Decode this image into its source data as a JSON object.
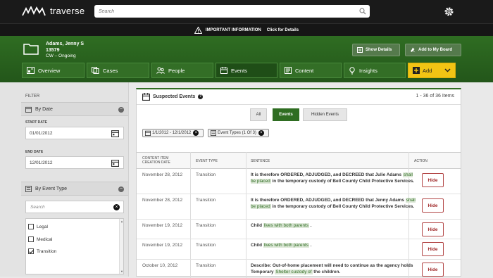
{
  "app": {
    "name": "traverse"
  },
  "search": {
    "placeholder": "Search"
  },
  "info_bar": {
    "label": "IMPORTANT INFORMATION",
    "link": "Click for Details"
  },
  "case": {
    "name": "Adams, Jenny S",
    "id": "13579",
    "status": "CW – Ongoing",
    "show_details": "Show Details",
    "add_board": "Add to My Board"
  },
  "tabs": [
    {
      "label": "Overview",
      "icon": "overview-icon"
    },
    {
      "label": "Cases",
      "icon": "cases-icon"
    },
    {
      "label": "People",
      "icon": "people-icon"
    },
    {
      "label": "Events",
      "icon": "events-icon"
    },
    {
      "label": "Content",
      "icon": "content-icon"
    },
    {
      "label": "Insights",
      "icon": "insights-icon"
    },
    {
      "label": "Add",
      "icon": "add-icon"
    }
  ],
  "sidebar": {
    "filter_label": "FILTER",
    "by_date": {
      "title": "By Date",
      "start_label": "START DATE",
      "start_value": "01/01/2012",
      "end_label": "END DATE",
      "end_value": "12/01/2012"
    },
    "by_event_type": {
      "title": "By Event Type",
      "search_placeholder": "Search",
      "options": [
        {
          "label": "Legal",
          "checked": false
        },
        {
          "label": "Medical",
          "checked": false
        },
        {
          "label": "Transition",
          "checked": true
        }
      ]
    }
  },
  "panel": {
    "title": "Suspected Events",
    "count": "1 - 36 of 36 Items",
    "segments": [
      "All",
      "Events",
      "Hidden Events"
    ],
    "active_segment": "Events",
    "chips": [
      "1/1/2012 - 12/1/2012",
      "Event Types (1 Of 3)"
    ],
    "columns": {
      "date_line1": "CONTENT ITEM",
      "date_line2": "CREATION DATE",
      "type": "EVENT TYPE",
      "sentence": "SENTENCE",
      "action": "ACTION"
    },
    "rows": [
      {
        "date": "November 28, 2012",
        "type": "Transition",
        "s1": "It is therefore ORDERED, ADJUDGED, and DECREED that Julie Adams",
        "hl": "shall be placed",
        "s2": "in the temporary custody of Bell County Child Protective Services.",
        "action": "Hide"
      },
      {
        "date": "November 28, 2012",
        "type": "Transition",
        "s1": "It is therefore ORDERED, ADJUDGED, and DECREED that Jenny Adams",
        "hl": "shall be placed",
        "s2": "in the temporary custody of Bell County Child Protective Services.",
        "action": "Hide"
      },
      {
        "date": "November 19, 2012",
        "type": "Transition",
        "s1": "Child",
        "hl": "lives with both parents",
        "s2": ".",
        "action": "Hide"
      },
      {
        "date": "November 19, 2012",
        "type": "Transition",
        "s1": "Child",
        "hl": "lives with both parents",
        "s2": ".",
        "action": "Hide"
      },
      {
        "date": "October 10, 2012",
        "type": "Transition",
        "s1": "Describe: Out-of-home placement will need to continue as the agency holds Temporary",
        "hl": "Shelter custody of",
        "s2": "the children.",
        "action": "Hide"
      }
    ]
  },
  "colors": {
    "topbar": "#1a1a1a",
    "green": "#2f6d22",
    "accent_yellow": "#f2c414",
    "hide_red": "#a12b2b"
  }
}
